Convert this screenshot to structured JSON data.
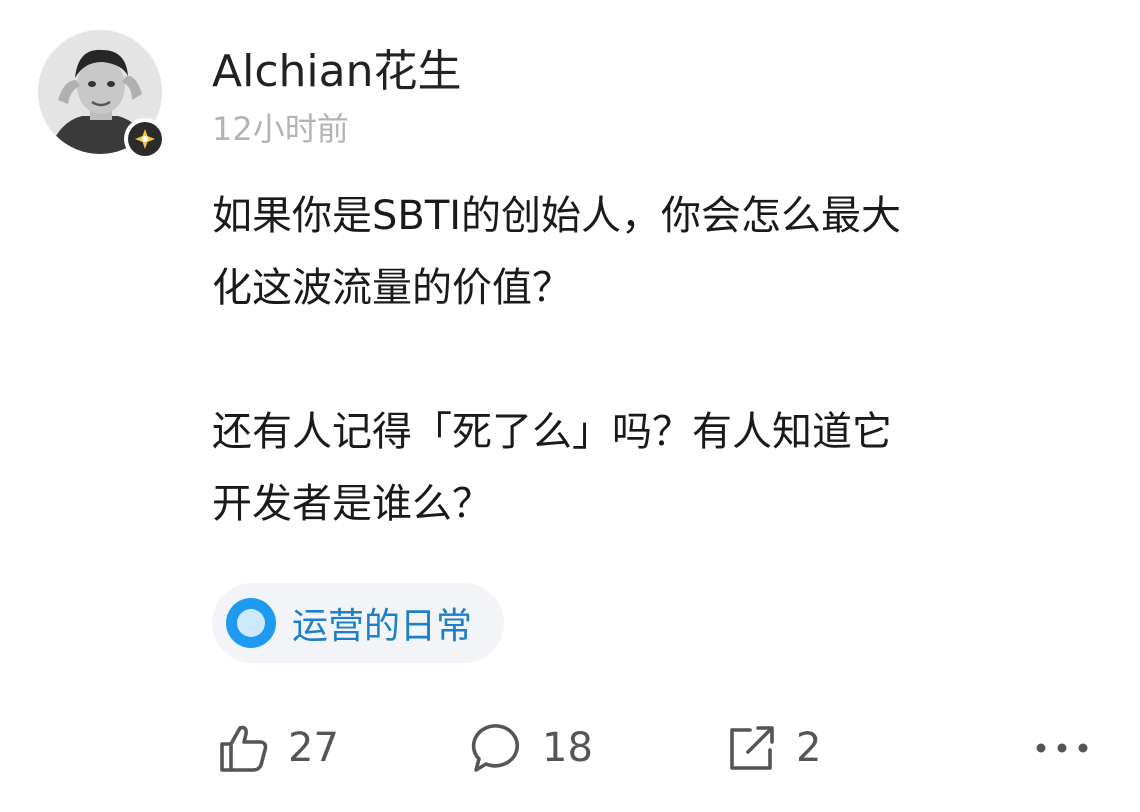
{
  "post": {
    "author": {
      "name": "Alchian花生",
      "avatar_icon": "avatar-photo",
      "badge_icon": "verified-badge-icon"
    },
    "timestamp": "12小时前",
    "paragraphs": [
      "如果你是SBTI的创始人，你会怎么最大\n化这波流量的价值？",
      "还有人记得「死了么」吗？有人知道它\n开发者是谁么？"
    ],
    "topic": {
      "label": "运营的日常",
      "icon": "topic-circle-icon",
      "color": "#1e9bf0"
    }
  },
  "actions": {
    "like": {
      "icon": "thumbs-up-icon",
      "count": "27"
    },
    "comment": {
      "icon": "comment-bubble-icon",
      "count": "18"
    },
    "share": {
      "icon": "share-arrow-icon",
      "count": "2"
    },
    "more": {
      "icon": "more-dots-icon"
    }
  }
}
